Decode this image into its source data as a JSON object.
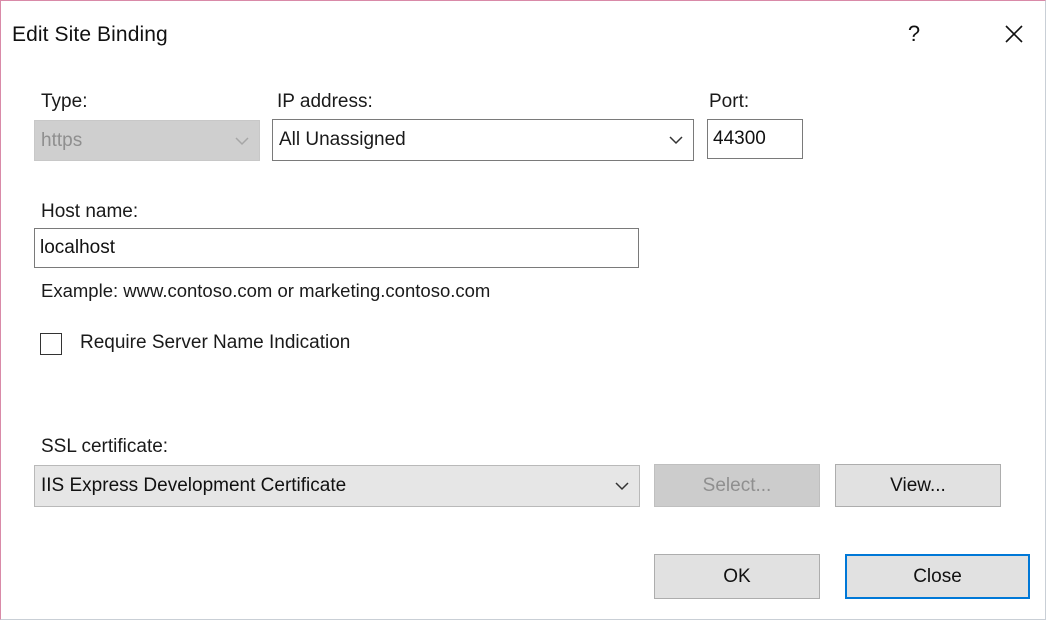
{
  "window": {
    "title": "Edit Site Binding",
    "help_label": "?",
    "close_icon": "close-icon"
  },
  "type": {
    "label": "Type:",
    "value": "https",
    "enabled": false
  },
  "ip_address": {
    "label": "IP address:",
    "value": "All Unassigned"
  },
  "port": {
    "label": "Port:",
    "value": "44300"
  },
  "host_name": {
    "label": "Host name:",
    "value": "localhost",
    "example": "Example: www.contoso.com or marketing.contoso.com"
  },
  "sni": {
    "label": "Require Server Name Indication",
    "checked": false
  },
  "ssl_certificate": {
    "label": "SSL certificate:",
    "value": "IIS Express Development Certificate",
    "select_label": "Select...",
    "view_label": "View..."
  },
  "buttons": {
    "ok_label": "OK",
    "close_label": "Close"
  },
  "colors": {
    "accent": "#0078d7",
    "window_border": "#d98aa8",
    "button_face": "#e1e1e1",
    "disabled_face": "#cccccc"
  }
}
